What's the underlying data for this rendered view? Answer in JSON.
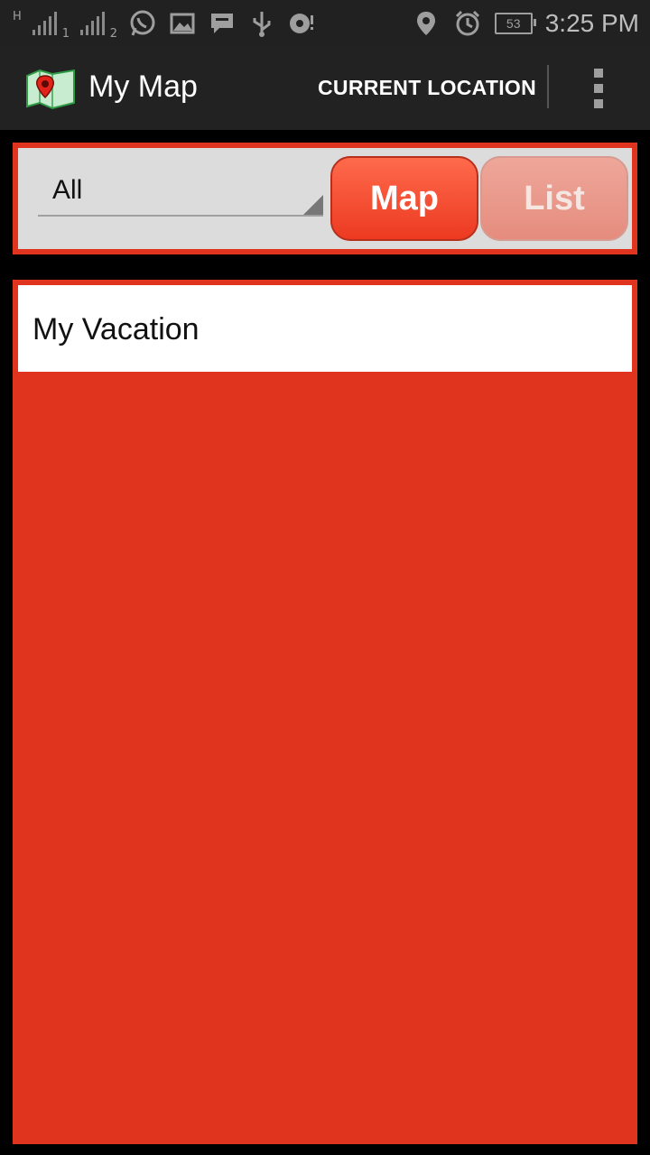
{
  "status_bar": {
    "network_label": "H",
    "sim1_label": "1",
    "sim2_label": "2",
    "battery": "53",
    "time": "3:25 PM",
    "icons": [
      "whatsapp-icon",
      "image-icon",
      "message-icon",
      "usb-icon",
      "sync-icon",
      "location-icon",
      "alarm-icon"
    ]
  },
  "action_bar": {
    "title": "My Map",
    "current_location_label": "CURRENT LOCATION"
  },
  "filter": {
    "selected": "All",
    "map_button": "Map",
    "list_button": "List"
  },
  "list": {
    "items": [
      {
        "label": "My Vacation"
      }
    ]
  },
  "colors": {
    "accent": "#e0341e",
    "actionbar": "#222222",
    "statusbar": "#212121"
  }
}
